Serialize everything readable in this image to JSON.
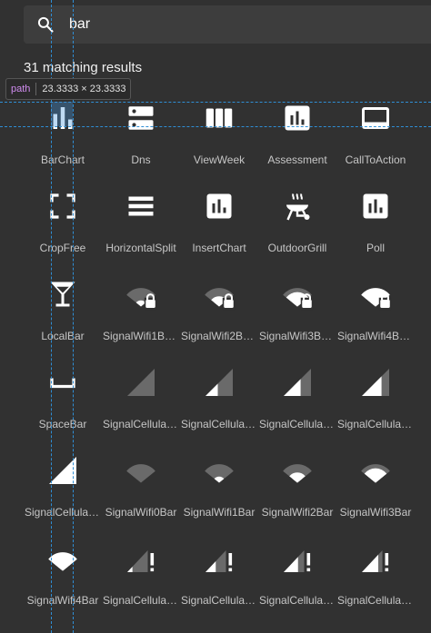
{
  "search": {
    "value": "bar"
  },
  "results_text": "31 matching results",
  "inspector": {
    "tag": "path",
    "size": "23.3333 × 23.3333"
  },
  "icons": [
    {
      "label": "BarChart",
      "icon": "bar-chart-icon"
    },
    {
      "label": "Dns",
      "icon": "dns-icon"
    },
    {
      "label": "ViewWeek",
      "icon": "view-week-icon"
    },
    {
      "label": "Assessment",
      "icon": "assessment-icon"
    },
    {
      "label": "CallToAction",
      "icon": "call-to-action-icon"
    },
    {
      "label": "CropFree",
      "icon": "crop-free-icon"
    },
    {
      "label": "HorizontalSplit",
      "icon": "horizontal-split-icon"
    },
    {
      "label": "InsertChart",
      "icon": "insert-chart-icon"
    },
    {
      "label": "OutdoorGrill",
      "icon": "outdoor-grill-icon"
    },
    {
      "label": "Poll",
      "icon": "poll-icon"
    },
    {
      "label": "LocalBar",
      "icon": "local-bar-icon"
    },
    {
      "label": "SignalWifi1Ba…",
      "icon": "signal-wifi-1-bar-lock-icon"
    },
    {
      "label": "SignalWifi2Ba…",
      "icon": "signal-wifi-2-bar-lock-icon"
    },
    {
      "label": "SignalWifi3Ba…",
      "icon": "signal-wifi-3-bar-lock-icon"
    },
    {
      "label": "SignalWifi4Ba…",
      "icon": "signal-wifi-4-bar-lock-icon"
    },
    {
      "label": "SpaceBar",
      "icon": "space-bar-icon"
    },
    {
      "label": "SignalCellular…",
      "icon": "signal-cellular-1-bar-icon"
    },
    {
      "label": "SignalCellular…",
      "icon": "signal-cellular-2-bar-icon"
    },
    {
      "label": "SignalCellular…",
      "icon": "signal-cellular-3-bar-icon"
    },
    {
      "label": "SignalCellular…",
      "icon": "signal-cellular-3-bar-b-icon"
    },
    {
      "label": "SignalCellular…",
      "icon": "signal-cellular-4-bar-icon"
    },
    {
      "label": "SignalWifi0Bar",
      "icon": "signal-wifi-0-bar-icon"
    },
    {
      "label": "SignalWifi1Bar",
      "icon": "signal-wifi-1-bar-icon"
    },
    {
      "label": "SignalWifi2Bar",
      "icon": "signal-wifi-2-bar-icon"
    },
    {
      "label": "SignalWifi3Bar",
      "icon": "signal-wifi-3-bar-icon"
    },
    {
      "label": "SignalWifi4Bar",
      "icon": "signal-wifi-4-bar-icon"
    },
    {
      "label": "SignalCellular…",
      "icon": "signal-cellular-1-bar-alert-icon"
    },
    {
      "label": "SignalCellular…",
      "icon": "signal-cellular-2-bar-alert-icon"
    },
    {
      "label": "SignalCellular…",
      "icon": "signal-cellular-3-bar-alert-icon"
    },
    {
      "label": "SignalCellular…",
      "icon": "signal-cellular-3-bar-alert-b-icon"
    }
  ]
}
